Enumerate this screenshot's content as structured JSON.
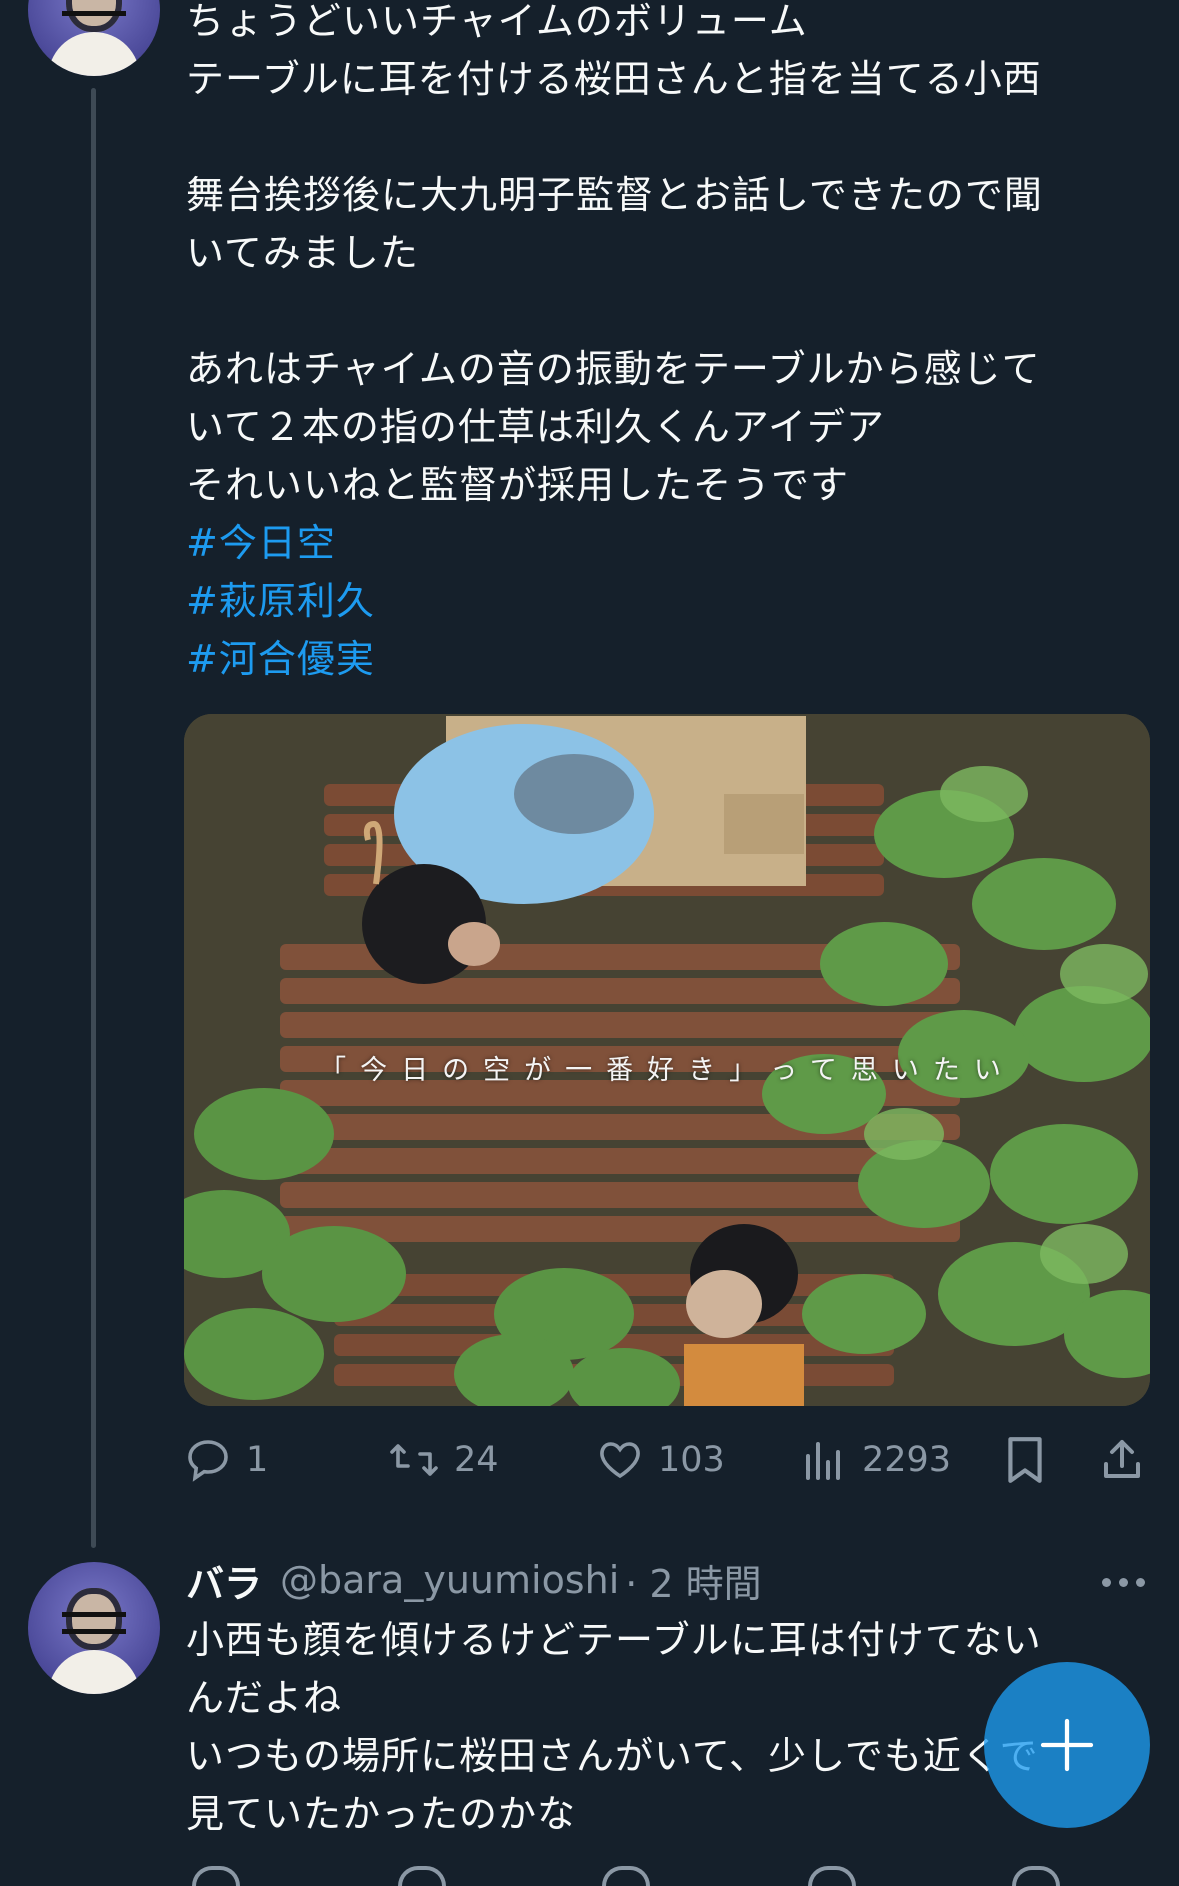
{
  "tweet1": {
    "lines": [
      "ちょうどいいチャイムのボリューム",
      "テーブルに耳を付ける桜田さんと指を当てる小西",
      "",
      "舞台挨拶後に大九明子監督とお話しできたので聞",
      "いてみました",
      "",
      "あれはチャイムの音の振動をテーブルから感じて",
      "いて２本の指の仕草は利久くんアイデア",
      "それいいねと監督が採用したそうです"
    ],
    "hashtags": [
      "#今日空",
      "#萩原利久",
      "#河合優実"
    ],
    "image_caption": "「今日の空が一番好き」って思いたい",
    "stats": {
      "replies": "1",
      "retweets": "24",
      "likes": "103",
      "views": "2293"
    }
  },
  "tweet2": {
    "name": "バラ",
    "handle": "@bara_yuumioshi",
    "time": "· 2 時間",
    "lines": [
      "小西も顔を傾けるけどテーブルに耳は付けてない",
      "んだよね",
      "いつもの場所に桜田さんがいて、少しでも近くで",
      "見ていたかったのかな"
    ]
  },
  "colors": {
    "background": "#15202b",
    "text": "#f7f9f9",
    "secondary": "#8b98a5",
    "accent": "#1d9bf0"
  }
}
